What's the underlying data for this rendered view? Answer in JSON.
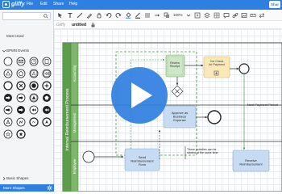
{
  "app": {
    "logo_text": "gliffy"
  },
  "menu": {
    "file": "File",
    "edit": "Edit",
    "share": "Share",
    "help": "Help"
  },
  "toolbar": {
    "zoom": "100%",
    "share_label": "Shar"
  },
  "doc": {
    "brand": "Gliffy",
    "title": "untitled"
  },
  "sidebar": {
    "sections": {
      "most_used": "Most Used",
      "bpmn_events": "BPMN Events",
      "basic_shapes": "Basic Shapes"
    },
    "more_shapes": "More Shapes"
  },
  "diagram": {
    "pool": "Internal Reimbursement Process",
    "lanes": {
      "accounting": "Accounting",
      "management": "Management",
      "employee": "Employee"
    },
    "tasks": {
      "review_receipt": "Review Receipt",
      "cut_check": "Cut Check for Payment",
      "approve": "Approve as Business Expense",
      "send": "Send Reimbursement Form",
      "receive": "Receive Reimbursement"
    },
    "notes": {
      "next_payment": "Next Payment Period",
      "parallel": "These activities can be started at the same time"
    }
  },
  "colors": {
    "brand": "#2f7fe0",
    "pool_green": "#5d9c4b",
    "task_blue": "#c7dcf3",
    "task_orange": "#fbe8b8",
    "task_green": "#cfe6c8"
  }
}
